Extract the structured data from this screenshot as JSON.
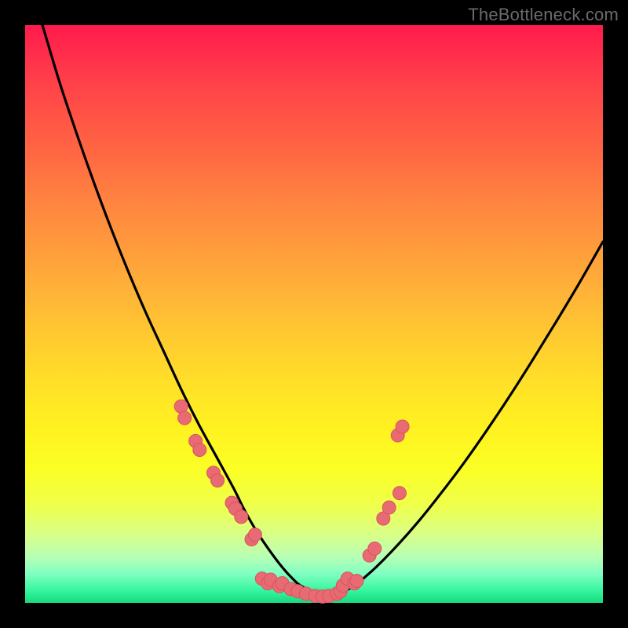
{
  "attribution": "TheBottleneck.com",
  "colors": {
    "page_bg": "#000000",
    "curve": "#000000",
    "marker_fill": "#e86a72",
    "marker_stroke": "#d85560",
    "gradient_top": "#ff1a4c",
    "gradient_bottom": "#17d87e"
  },
  "chart_data": {
    "type": "line",
    "title": "",
    "xlabel": "",
    "ylabel": "",
    "xlim": [
      0,
      100
    ],
    "ylim": [
      0,
      100
    ],
    "grid": false,
    "legend": false,
    "series": [
      {
        "name": "bottleneck-curve",
        "x": [
          3,
          6,
          9,
          12,
          15,
          18,
          21,
          24,
          27,
          30,
          33,
          36,
          38,
          40,
          42,
          44,
          46,
          48,
          52,
          56,
          60,
          64,
          68,
          72,
          76,
          80,
          84,
          88,
          92,
          96,
          100
        ],
        "y": [
          100,
          90,
          81,
          72.5,
          64.5,
          57,
          50,
          43.5,
          37,
          31,
          25.5,
          20,
          16,
          12.5,
          9.5,
          6.8,
          4.5,
          2.8,
          1.2,
          2.4,
          5.5,
          9.5,
          14,
          19,
          24.3,
          30,
          36,
          42.3,
          48.8,
          55.5,
          62.5
        ]
      }
    ],
    "markers": [
      {
        "x": 27.0,
        "y": 34.0
      },
      {
        "x": 27.6,
        "y": 32.0
      },
      {
        "x": 29.5,
        "y": 28.0
      },
      {
        "x": 30.2,
        "y": 26.5
      },
      {
        "x": 32.6,
        "y": 22.5
      },
      {
        "x": 33.3,
        "y": 21.2
      },
      {
        "x": 35.8,
        "y": 17.3
      },
      {
        "x": 36.4,
        "y": 16.3
      },
      {
        "x": 37.4,
        "y": 14.9
      },
      {
        "x": 39.2,
        "y": 11.0
      },
      {
        "x": 39.8,
        "y": 11.8
      },
      {
        "x": 41.0,
        "y": 4.2
      },
      {
        "x": 42.0,
        "y": 3.4
      },
      {
        "x": 42.5,
        "y": 4.0
      },
      {
        "x": 44.0,
        "y": 2.9
      },
      {
        "x": 44.5,
        "y": 3.4
      },
      {
        "x": 46.0,
        "y": 2.4
      },
      {
        "x": 47.2,
        "y": 2.0
      },
      {
        "x": 48.6,
        "y": 1.6
      },
      {
        "x": 50.2,
        "y": 1.2
      },
      {
        "x": 51.5,
        "y": 1.1
      },
      {
        "x": 52.6,
        "y": 1.2
      },
      {
        "x": 54.0,
        "y": 1.6
      },
      {
        "x": 54.6,
        "y": 2.0
      },
      {
        "x": 55.0,
        "y": 3.0
      },
      {
        "x": 55.8,
        "y": 4.2
      },
      {
        "x": 57.0,
        "y": 3.4
      },
      {
        "x": 57.4,
        "y": 3.8
      },
      {
        "x": 59.6,
        "y": 8.2
      },
      {
        "x": 60.5,
        "y": 9.4
      },
      {
        "x": 62.0,
        "y": 14.6
      },
      {
        "x": 63.0,
        "y": 16.5
      },
      {
        "x": 64.8,
        "y": 19.0
      },
      {
        "x": 64.5,
        "y": 29.0
      },
      {
        "x": 65.3,
        "y": 30.5
      }
    ]
  }
}
